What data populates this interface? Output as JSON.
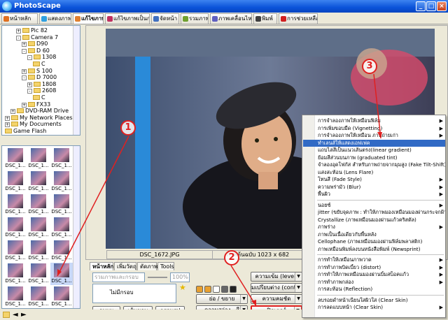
{
  "window": {
    "title": "PhotoScape"
  },
  "tabs": [
    {
      "label": "หน้าหลัก",
      "color": "#e07020"
    },
    {
      "label": "แสดงภาพ",
      "color": "#30a0e0"
    },
    {
      "label": "แก้ไขภาพ",
      "color": "#e08030"
    },
    {
      "label": "แก้ไขภาพเป็นกลุ่ม",
      "color": "#c03060"
    },
    {
      "label": "จัดหน้า",
      "color": "#4070c0"
    },
    {
      "label": "รวมภาพ",
      "color": "#70a030"
    },
    {
      "label": "ภาพเคลื่อนไหว",
      "color": "#6060c0"
    },
    {
      "label": "พิมพ์",
      "color": "#404040"
    },
    {
      "label": "การช่วยเหลือ",
      "color": "#d02020"
    }
  ],
  "tree": [
    {
      "label": "Pic 82",
      "level": 3,
      "pm": "+"
    },
    {
      "label": "Camera 7",
      "level": 3,
      "pm": "-"
    },
    {
      "label": "D90",
      "level": 4,
      "pm": "+"
    },
    {
      "label": "D 60",
      "level": 4,
      "pm": "-"
    },
    {
      "label": "1308",
      "level": 5,
      "pm": "-"
    },
    {
      "label": "C",
      "level": 6,
      "pm": ""
    },
    {
      "label": "S 100",
      "level": 4,
      "pm": "+"
    },
    {
      "label": "D 7000",
      "level": 4,
      "pm": "-"
    },
    {
      "label": "1808",
      "level": 5,
      "pm": "+"
    },
    {
      "label": "2608",
      "level": 5,
      "pm": "-"
    },
    {
      "label": "C",
      "level": 6,
      "pm": ""
    },
    {
      "label": "FX33",
      "level": 4,
      "pm": "+"
    },
    {
      "label": "DVD-RAM Drive",
      "level": 2,
      "pm": "+"
    },
    {
      "label": "My Network Places",
      "level": 1,
      "pm": "+"
    },
    {
      "label": "My Documents",
      "level": 1,
      "pm": "+"
    },
    {
      "label": "Game Flash",
      "level": 1,
      "pm": ""
    }
  ],
  "thumbnails": [
    {
      "label": "DSC_1..."
    },
    {
      "label": "DSC_1..."
    },
    {
      "label": "DSC_1..."
    },
    {
      "label": "DSC_1..."
    },
    {
      "label": "DSC_1..."
    },
    {
      "label": "DSC_1..."
    },
    {
      "label": "DSC_1..."
    },
    {
      "label": "DSC_1..."
    },
    {
      "label": "DSC_1..."
    },
    {
      "label": "DSC_1..."
    },
    {
      "label": "DSC_1..."
    },
    {
      "label": "DSC_1..."
    },
    {
      "label": "DSC_1..."
    },
    {
      "label": "DSC_1..."
    },
    {
      "label": "DSC_1..."
    },
    {
      "label": "DSC_1..."
    },
    {
      "label": "DSC_1..."
    },
    {
      "label": "DSC_1..."
    },
    {
      "label": "DSC_1..."
    },
    {
      "label": "DSC_1..."
    },
    {
      "label": "DSC_1..."
    }
  ],
  "viewer": {
    "filename": "DSC_1672.JPG",
    "dimensions": "ภาพต้นฉบับ 1023 x 682"
  },
  "editor": {
    "tabs": [
      "หน้าหลัก",
      "เพิ่มวัตถุ",
      "ตัดภาพ",
      "Tools"
    ],
    "frame_combo_placeholder": "รวมภาพเเละกรอบ",
    "zoom_value": "100%",
    "frame_select": "ไม่มีกรอบ",
    "buttons": {
      "rotate": "ลบมุม",
      "border": "เส้นขอบ",
      "frame": "กรอบรูป",
      "resize": "ย่อ / ขยาย",
      "brightness": "ความสว่าง , สี",
      "level": "ความเข้ม (level)",
      "contrast": "มเปรียบต่าง (contra",
      "sharpen": "ความคมชัด",
      "filter": "ฟิลเตอร์"
    }
  },
  "menu": {
    "items": [
      {
        "label": "การจำลองภาพให้เหมือนฟิล์ม",
        "arrow": true
      },
      {
        "label": "การเพิ่มขอบมืด (Vignetting)",
        "arrow": true
      },
      {
        "label": "การจำลองภาพให้เหมือน ภาพถ่ายเก่า",
        "arrow": true
      },
      {
        "label": "ทำเลนส์ให้แสดงเอฟเฟค",
        "arrow": false,
        "highlight": true
      },
      {
        "label": "แถบไล่สีเป็นแนวเส้นตรง(linear gradient)",
        "arrow": false
      },
      {
        "label": "ย้อมสีส่วนบนภาพ (graduated tint)",
        "arrow": false
      },
      {
        "label": "จำลองอุดโฟกัส สำหรับภาพถ่ายจากมุมสูง (Fake Tilt-Shift)",
        "arrow": false
      },
      {
        "label": "แสงสะท้อน (Lens Flare)",
        "arrow": false
      },
      {
        "label": "โทนสี (Fade Style)",
        "arrow": true
      },
      {
        "label": "ความพร่ามัว (Blur)",
        "arrow": true
      },
      {
        "label": "พื้นผิว",
        "arrow": true
      },
      {
        "sep": true
      },
      {
        "label": "นอยซ์",
        "arrow": true
      },
      {
        "label": "jitter (ขยับจุดภาพ : ทำให้ภาพมองเหมือนมองผ่านกระจกฝ้า)",
        "arrow": false
      },
      {
        "label": "Crystallize (ภาพเหมือนมองผ่านแก้วคริสตัล)",
        "arrow": false
      },
      {
        "label": "ภาพร่าง",
        "arrow": true
      },
      {
        "label": "ภาพเป็นเนื้อเดียวกับพื้นหลัง",
        "arrow": false
      },
      {
        "label": "Cellophane (ภาพเหมือนมองผ่านฟิล์มพลาสติก)",
        "arrow": false
      },
      {
        "label": "ภาพเหมือนพิมพ์ลงบนหนังสือพิมพ์ (Newsprint)",
        "arrow": false
      },
      {
        "sep": true
      },
      {
        "label": "การทำให้เหมือนภาพวาด",
        "arrow": true
      },
      {
        "label": "การทำภาพบิดเบี้ยว (distort)",
        "arrow": true
      },
      {
        "label": "การทำให้ภาพเหมือนมองผ่านบิ้มสบ็อคแก้ว",
        "arrow": true
      },
      {
        "label": "การทำภาพกล่อง",
        "arrow": true
      },
      {
        "label": "การสะท้อน (Reflection)",
        "arrow": false
      },
      {
        "sep": true
      },
      {
        "label": "ลบรอยดำหน้าเนียนใสผิวใส (Clear Skin)",
        "arrow": false
      },
      {
        "label": "การลดแบบหน้า (Clear Skin)",
        "arrow": true
      }
    ]
  },
  "annotations": [
    {
      "label": "1"
    },
    {
      "label": "2"
    },
    {
      "label": "3"
    }
  ],
  "colors": {
    "annotation": "#e02020",
    "highlight": "#316ac5",
    "titlebar": "#0a52d9"
  }
}
